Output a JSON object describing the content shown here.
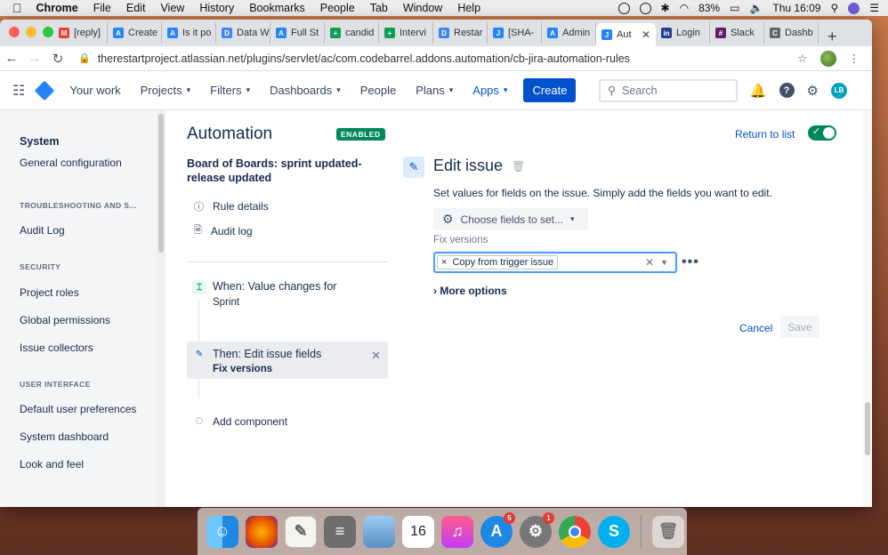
{
  "menubar": {
    "app": "Chrome",
    "menus": [
      "File",
      "Edit",
      "View",
      "History",
      "Bookmarks",
      "People",
      "Tab",
      "Window",
      "Help"
    ],
    "battery": "83%",
    "clock": "Thu 16:09"
  },
  "tabs": [
    {
      "label": "[reply]",
      "fav": "M",
      "color": "#ea4335"
    },
    {
      "label": "Create",
      "fav": "A",
      "color": "#2684ff"
    },
    {
      "label": "Is it po",
      "fav": "A",
      "color": "#2684ff"
    },
    {
      "label": "Data W",
      "fav": "D",
      "color": "#4285f4"
    },
    {
      "label": "Full St",
      "fav": "A",
      "color": "#2684ff"
    },
    {
      "label": "candid",
      "fav": "+",
      "color": "#0f9d58"
    },
    {
      "label": "Intervi",
      "fav": "+",
      "color": "#0f9d58"
    },
    {
      "label": "Restar",
      "fav": "D",
      "color": "#4285f4"
    },
    {
      "label": "[SHA-",
      "fav": "J",
      "color": "#2684ff"
    },
    {
      "label": "Admin",
      "fav": "A",
      "color": "#2684ff"
    },
    {
      "label": "Aut",
      "fav": "J",
      "color": "#2684ff",
      "active": true
    },
    {
      "label": "Login",
      "fav": "in",
      "color": "#283e8a"
    },
    {
      "label": "Slack",
      "fav": "#",
      "color": "#611f69"
    },
    {
      "label": "Dashb",
      "fav": "C",
      "color": "#666666"
    }
  ],
  "omnibox": {
    "url": "therestartproject.atlassian.net/plugins/servlet/ac/com.codebarrel.addons.automation/cb-jira-automation-rules"
  },
  "jira_nav": {
    "items": [
      "Your work",
      "Projects",
      "Filters",
      "Dashboards",
      "People",
      "Plans",
      "Apps"
    ],
    "create": "Create",
    "search_placeholder": "Search",
    "avatar": "LB"
  },
  "sidebar": {
    "system": "System",
    "general": "General configuration",
    "troubleshooting_head": "TROUBLESHOOTING AND S...",
    "audit_log": "Audit Log",
    "security_head": "SECURITY",
    "project_roles": "Project roles",
    "global_permissions": "Global permissions",
    "issue_collectors": "Issue collectors",
    "ui_head": "USER INTERFACE",
    "default_prefs": "Default user preferences",
    "system_dashboard": "System dashboard",
    "look_feel": "Look and feel"
  },
  "automation": {
    "title": "Automation",
    "status": "ENABLED",
    "return": "Return to list",
    "rule_name": "Board of Boards: sprint updated-release updated",
    "rule_details": "Rule details",
    "audit_log": "Audit log",
    "trigger_title": "When: Value changes for",
    "trigger_sub": "Sprint",
    "action_title": "Then: Edit issue fields",
    "action_sub": "Fix versions",
    "add_component": "Add component"
  },
  "edit": {
    "title": "Edit issue",
    "description": "Set values for fields on the issue. Simply add the fields you want to edit.",
    "choose": "Choose fields to set...",
    "fix_label": "Fix versions",
    "chip": "Copy from trigger issue",
    "more_options": "More options",
    "cancel": "Cancel",
    "save": "Save"
  }
}
